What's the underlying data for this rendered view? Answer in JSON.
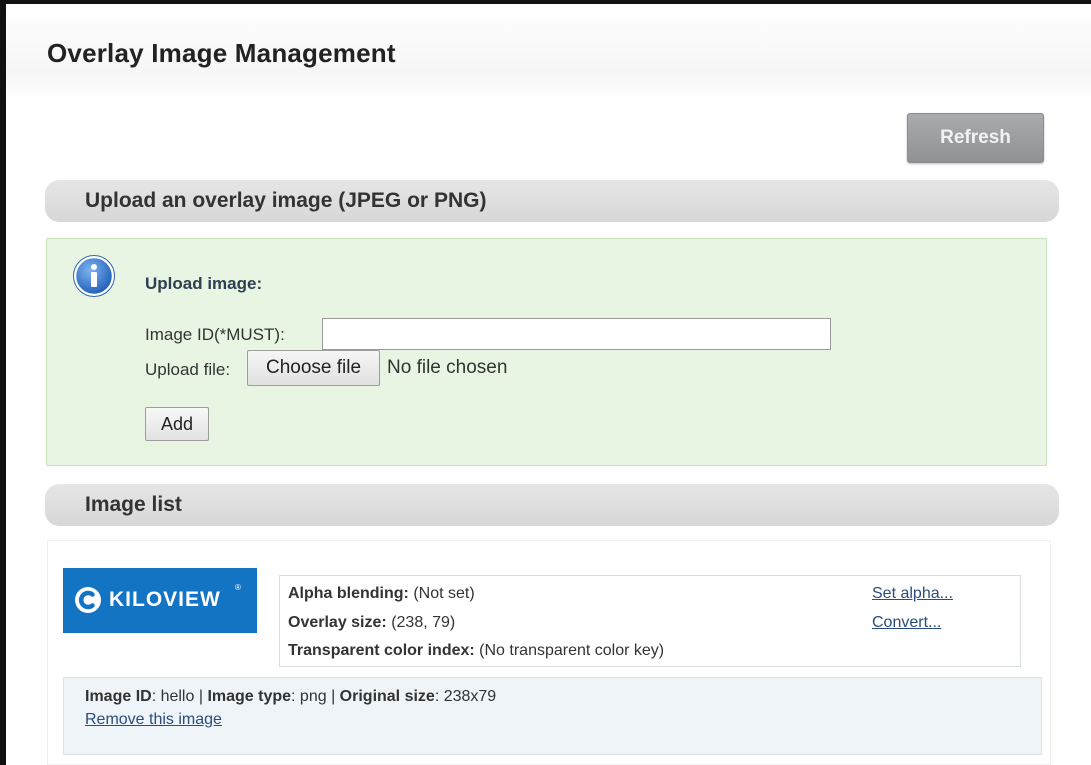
{
  "page": {
    "title": "Overlay Image Management",
    "refresh_label": "Refresh"
  },
  "upload_section": {
    "header": "Upload an overlay image (JPEG or PNG)",
    "heading": "Upload image:",
    "image_id_label": "Image ID(*MUST):",
    "image_id_value": "",
    "upload_file_label": "Upload file:",
    "choose_file_label": "Choose file",
    "no_file_text": "No file chosen",
    "add_label": "Add",
    "icon": "info-icon"
  },
  "image_list": {
    "header": "Image list",
    "items": [
      {
        "logo_text": "KILOVIEW",
        "logo_mark": "®",
        "alpha_label": "Alpha blending:",
        "alpha_value": "(Not set)",
        "overlay_size_label": "Overlay size:",
        "overlay_size_value": "(238, 79)",
        "transparent_label": "Transparent color index:",
        "transparent_value": "(No transparent color key)",
        "set_alpha_link": "Set alpha...",
        "convert_link": "Convert...",
        "image_id_label": "Image ID",
        "image_id_value": ": hello | ",
        "image_type_label": "Image type",
        "image_type_value": ": png | ",
        "original_size_label": "Original size",
        "original_size_value": ": 238x79",
        "remove_link": "Remove this image"
      }
    ]
  },
  "colors": {
    "upload_panel_bg": "#e8f5e2",
    "logo_bg": "#1474c4",
    "link": "#2a4d7d",
    "info_icon": "#3b7fd1"
  }
}
